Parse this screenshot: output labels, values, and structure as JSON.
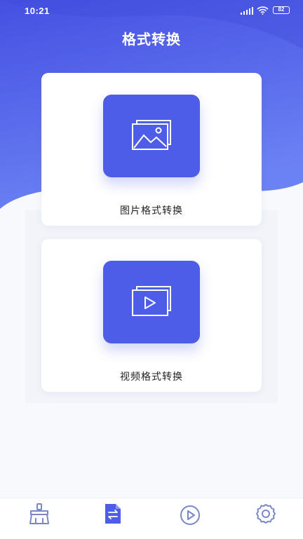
{
  "status_bar": {
    "time": "10:21",
    "battery": "82"
  },
  "header": {
    "title": "格式转换"
  },
  "cards": [
    {
      "label": "图片格式转换",
      "icon": "image-gallery-icon"
    },
    {
      "label": "视频格式转换",
      "icon": "video-gallery-icon"
    }
  ],
  "tab_bar": {
    "tabs": [
      {
        "icon": "broom-clean-icon",
        "active": false
      },
      {
        "icon": "file-convert-icon",
        "active": true
      },
      {
        "icon": "play-circle-icon",
        "active": false
      },
      {
        "icon": "gear-icon",
        "active": false
      }
    ]
  },
  "colors": {
    "accent": "#4d5de8",
    "header_gradient_start": "#4754e4",
    "header_gradient_end": "#6a7ff3",
    "tab_inactive": "#7a88c8"
  }
}
